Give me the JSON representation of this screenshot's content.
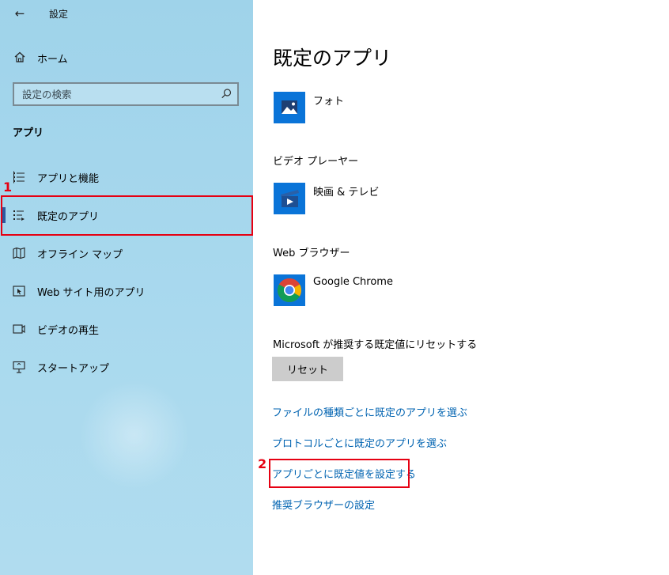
{
  "window": {
    "title": "設定",
    "back_icon": "back-arrow-icon"
  },
  "sidebar": {
    "home_label": "ホーム",
    "search_placeholder": "設定の検索",
    "section_header": "アプリ",
    "items": [
      {
        "label": "アプリと機能",
        "icon": "apps-features-icon",
        "selected": false
      },
      {
        "label": "既定のアプリ",
        "icon": "default-apps-icon",
        "selected": true
      },
      {
        "label": "オフライン マップ",
        "icon": "offline-maps-icon",
        "selected": false
      },
      {
        "label": "Web サイト用のアプリ",
        "icon": "apps-for-websites-icon",
        "selected": false
      },
      {
        "label": "ビデオの再生",
        "icon": "video-playback-icon",
        "selected": false
      },
      {
        "label": "スタートアップ",
        "icon": "startup-icon",
        "selected": false
      }
    ]
  },
  "content": {
    "title": "既定のアプリ",
    "photo_app": "フォト",
    "video_label": "ビデオ プレーヤー",
    "video_app": "映画 & テレビ",
    "web_label": "Web ブラウザー",
    "web_app": "Google Chrome",
    "reset_description": "Microsoft が推奨する既定値にリセットする",
    "reset_button": "リセット",
    "links": [
      "ファイルの種類ごとに既定のアプリを選ぶ",
      "プロトコルごとに既定のアプリを選ぶ",
      "アプリごとに既定値を設定する",
      "推奨ブラウザーの設定"
    ]
  },
  "annotations": {
    "step1": "1",
    "step2": "2"
  },
  "colors": {
    "accent": "#2b5aa0",
    "link": "#0063b1",
    "annotation": "#e60012",
    "tile": "#0a74d8"
  }
}
